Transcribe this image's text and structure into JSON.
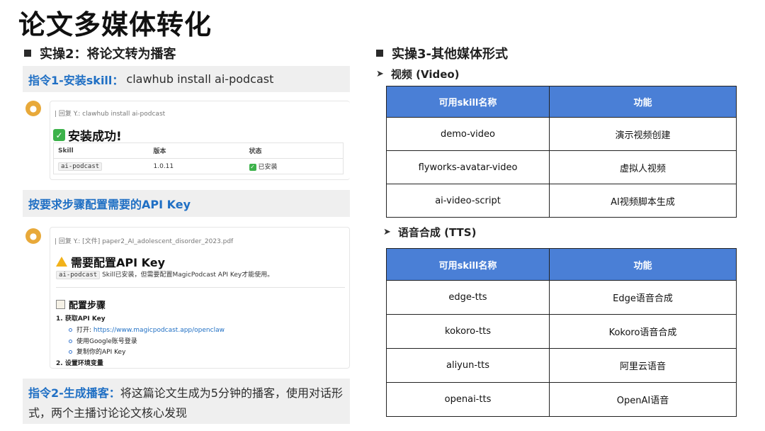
{
  "title": "论文多媒体转化",
  "left": {
    "heading": "实操2：将论文转为播客",
    "cmd1": {
      "label": "指令1-安装skill：",
      "text": "clawhub install ai-podcast"
    },
    "card1": {
      "reply": "| 回复 Y.: clawhub install ai-podcast",
      "status_title": "安装成功!",
      "table": {
        "headers": [
          "Skill",
          "版本",
          "状态"
        ],
        "row": {
          "skill": "ai-podcast",
          "version": "1.0.11",
          "status": "已安装"
        }
      }
    },
    "band2": "按要求步骤配置需要的API Key",
    "card2": {
      "reply": "| 回复 Y.: [文件] paper2_AI_adolescent_disorder_2023.pdf",
      "warn_title": "需要配置API Key",
      "code": "ai-podcast",
      "desc": "Skill已安装，但需要配置MagicPodcast API Key才能使用。",
      "steps_title": "配置步骤",
      "step1": "1. 获取API Key",
      "sub1_prefix": "打开: ",
      "sub1_link": "https://www.magicpodcast.app/openclaw",
      "sub2": "使用Google账号登录",
      "sub3": "复制你的API Key",
      "step2": "2. 设置环境变量"
    },
    "cmd2": {
      "label": "指令2-生成播客：",
      "text": "将这篇论文生成为5分钟的播客，使用对话形式，两个主播讨论论文核心发现"
    }
  },
  "right": {
    "heading": "实操3-其他媒体形式",
    "video": {
      "label": "视频 (Video)",
      "headers": [
        "可用skill名称",
        "功能"
      ],
      "rows": [
        {
          "name": "demo-video",
          "func": "演示视频创建"
        },
        {
          "name": "flyworks-avatar-video",
          "func": "虚拟人视频"
        },
        {
          "name": "ai-video-script",
          "func": "AI视频脚本生成"
        }
      ]
    },
    "tts": {
      "label": "语音合成 (TTS)",
      "headers": [
        "可用skill名称",
        "功能"
      ],
      "rows": [
        {
          "name": "edge-tts",
          "func": "Edge语音合成"
        },
        {
          "name": "kokoro-tts",
          "func": "Kokoro语音合成"
        },
        {
          "name": "aliyun-tts",
          "func": "阿里云语音"
        },
        {
          "name": "openai-tts",
          "func": "OpenAI语音"
        }
      ]
    }
  },
  "colors": {
    "accent_blue": "#1f6fc4",
    "table_header": "#4a7fd6",
    "band_bg": "#efefef"
  }
}
